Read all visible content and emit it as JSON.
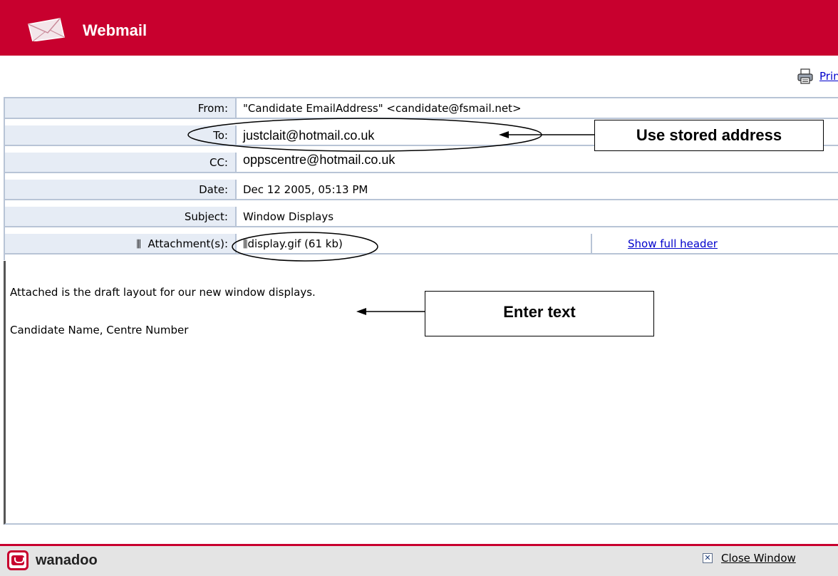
{
  "app": {
    "title": "Webmail"
  },
  "toolbar": {
    "print_label": "Print"
  },
  "header_fields": {
    "from_label": "From:",
    "from_value": "\"Candidate EmailAddress\" <candidate@fsmail.net>",
    "to_label": "To:",
    "to_value": "justclait@hotmail.co.uk",
    "cc_label": "CC:",
    "cc_value": "oppscentre@hotmail.co.uk",
    "date_label": "Date:",
    "date_value": "Dec 12 2005, 05:13 PM",
    "subject_label": "Subject:",
    "subject_value": "Window Displays",
    "attachment_label": "Attachment(s):",
    "attachment_value": "display.gif (61 kb)",
    "show_full_header": "Show full header"
  },
  "message": {
    "line1": "Attached is the draft layout for our new window displays.",
    "line2": "Candidate Name, Centre Number"
  },
  "annotations": {
    "stored_address": "Use stored address",
    "enter_text": "Enter text"
  },
  "footer": {
    "brand": "wanadoo",
    "close_label": "Close Window"
  },
  "colors": {
    "brand_red": "#c8002e",
    "header_cell_bg": "#e6ecf5",
    "border": "#b8c4d6",
    "link": "#0000cc"
  }
}
